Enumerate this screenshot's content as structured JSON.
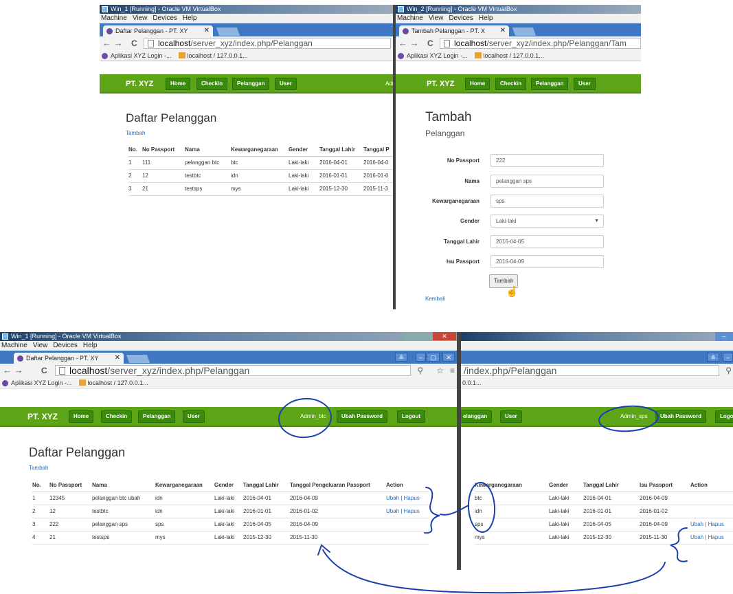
{
  "win1": {
    "title": "Win_1 [Running] - Oracle VM VirtualBox",
    "menu": [
      "Machine",
      "View",
      "Devices",
      "Help"
    ],
    "tab": "Daftar Pelanggan - PT. XY",
    "url_host": "localhost",
    "url_path": "/server_xyz/index.php/Pelanggan",
    "bookmarks": [
      "Aplikasi XYZ Login -...",
      "localhost / 127.0.0.1..."
    ],
    "brand": "PT. XYZ",
    "nav": [
      "Home",
      "Checkin",
      "Pelanggan",
      "User"
    ],
    "admin_partial": "Adm",
    "heading": "Daftar Pelanggan",
    "tambah": "Tambah",
    "columns": [
      "No.",
      "No Passport",
      "Nama",
      "Kewarganegaraan",
      "Gender",
      "Tanggal Lahir",
      "Tanggal P"
    ],
    "rows": [
      [
        "1",
        "111",
        "pelanggan btc",
        "btc",
        "Laki-laki",
        "2016-04-01",
        "2016-04-0"
      ],
      [
        "2",
        "12",
        "testbtc",
        "idn",
        "Laki-laki",
        "2016-01-01",
        "2016-01-0"
      ],
      [
        "3",
        "21",
        "testsps",
        "mys",
        "Laki-laki",
        "2015-12-30",
        "2015-11-3"
      ]
    ]
  },
  "win2": {
    "title": "Win_2 [Running] - Oracle VM VirtualBox",
    "menu": [
      "Machine",
      "View",
      "Devices",
      "Help"
    ],
    "tab": "Tambah Pelanggan - PT. X",
    "url_host": "localhost",
    "url_path": "/server_xyz/index.php/Pelanggan/Tam",
    "bookmarks": [
      "Aplikasi XYZ Login -...",
      "localhost / 127.0.0.1..."
    ],
    "brand": "PT. XYZ",
    "nav": [
      "Home",
      "Checkin",
      "Pelanggan",
      "User"
    ],
    "heading": "Tambah",
    "subheading": "Pelanggan",
    "fields": [
      {
        "label": "No Passport",
        "value": "222"
      },
      {
        "label": "Nama",
        "value": "pelanggan sps"
      },
      {
        "label": "Kewarganegaraan",
        "value": "sps"
      },
      {
        "label": "Gender",
        "value": "Laki-laki"
      },
      {
        "label": "Tanggal Lahir",
        "value": "2016-04-05"
      },
      {
        "label": "Isu Passport",
        "value": "2016-04-09"
      }
    ],
    "submit": "Tambah",
    "kembali": "Kembali"
  },
  "win3": {
    "title": "Win_1 [Running] - Oracle VM VirtualBox",
    "menu": [
      "Machine",
      "View",
      "Devices",
      "Help"
    ],
    "tab": "Daftar Pelanggan - PT. XY",
    "url_host": "localhost",
    "url_path": "/server_xyz/index.php/Pelanggan",
    "bookmarks": [
      "Aplikasi XYZ Login -...",
      "localhost / 127.0.0.1..."
    ],
    "brand": "PT. XYZ",
    "nav": [
      "Home",
      "Checkin",
      "Pelanggan",
      "User"
    ],
    "admin": "Admin_btc",
    "ubah_password": "Ubah Password",
    "logout": "Logout",
    "heading": "Daftar Pelanggan",
    "tambah": "Tambah",
    "columns": [
      "No.",
      "No Passport",
      "Nama",
      "Kewarganegaraan",
      "Gender",
      "Tanggal Lahir",
      "Tanggal Pengeluaran Passport",
      "Action"
    ],
    "rows": [
      [
        "1",
        "12345",
        "pelanggan btc ubah",
        "idn",
        "Laki-laki",
        "2016-04-01",
        "2016-04-09",
        "Ubah | Hapus"
      ],
      [
        "2",
        "12",
        "testbtc",
        "idn",
        "Laki-laki",
        "2016-01-01",
        "2016-01-02",
        "Ubah | Hapus"
      ],
      [
        "3",
        "222",
        "pelanggan sps",
        "sps",
        "Laki-laki",
        "2016-04-05",
        "2016-04-09",
        ""
      ],
      [
        "4",
        "21",
        "testsps",
        "mys",
        "Laki-laki",
        "2015-12-30",
        "2015-11-30",
        ""
      ]
    ]
  },
  "win4": {
    "url_partial": "/index.php/Pelanggan",
    "bm_partial": "0.0.1...",
    "nav_partial": [
      "elanggan",
      "User"
    ],
    "admin": "Admin_sps",
    "ubah_password": "Ubah Password",
    "logout_partial": "Logou",
    "columns": [
      "Kewarganegaraan",
      "Gender",
      "Tanggal Lahir",
      "Isu Passport",
      "Action"
    ],
    "rows": [
      [
        "btc",
        "Laki-laki",
        "2016-04-01",
        "2016-04-09",
        ""
      ],
      [
        "idn",
        "Laki-laki",
        "2016-01-01",
        "2016-01-02",
        ""
      ],
      [
        "sps",
        "Laki-laki",
        "2016-04-05",
        "2016-04-09",
        "Ubah | Hapus"
      ],
      [
        "mys",
        "Laki-laki",
        "2015-12-30",
        "2015-11-30",
        "Ubah | Hapus"
      ]
    ]
  }
}
